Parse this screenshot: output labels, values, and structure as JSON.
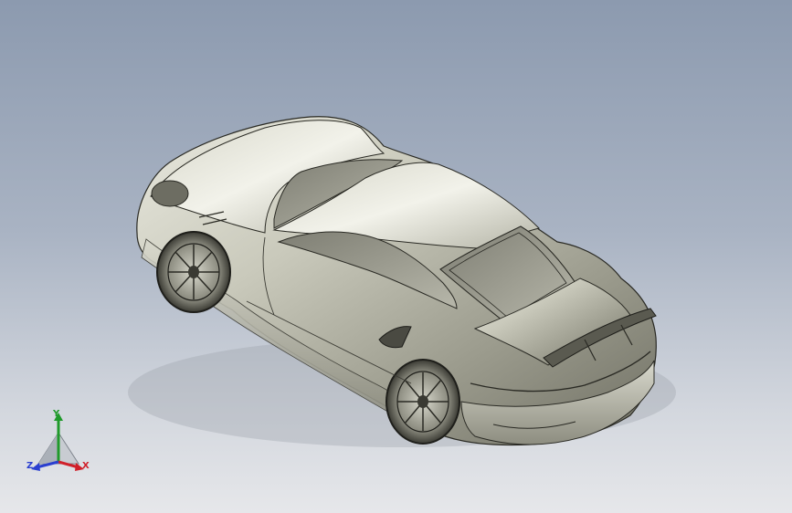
{
  "viewport": {
    "background_top": "#8c9aaf",
    "background_bottom": "#e6e7ea",
    "model": "car-body-3d-model"
  },
  "triad": {
    "x_label": "X",
    "y_label": "Y",
    "z_label": "Z",
    "x_color": "#d0202a",
    "y_color": "#1f9a2a",
    "z_color": "#2a3fd0"
  }
}
